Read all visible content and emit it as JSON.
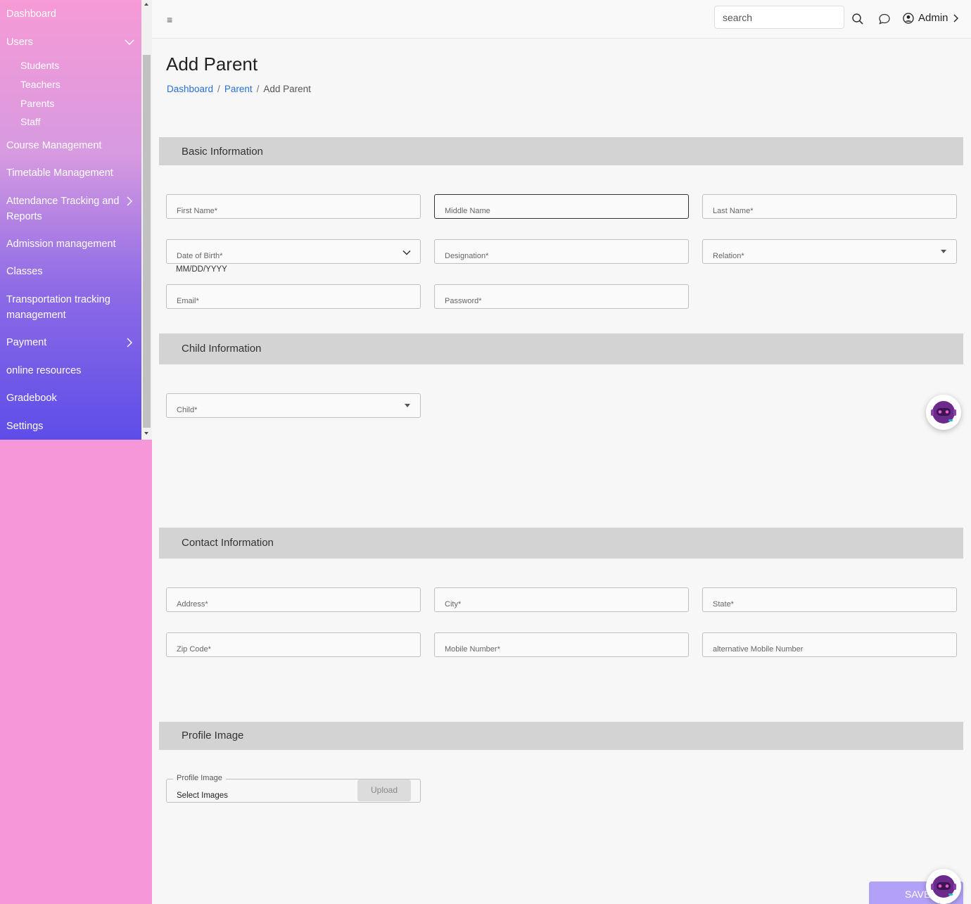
{
  "sidebar": {
    "items": [
      {
        "label": "Dashboard"
      },
      {
        "label": "Users"
      },
      {
        "label": "Course Management"
      },
      {
        "label": "Timetable Management"
      },
      {
        "label": "Attendance Tracking and Reports"
      },
      {
        "label": "Admission management"
      },
      {
        "label": "Classes"
      },
      {
        "label": "Transportation tracking management"
      },
      {
        "label": "Payment"
      },
      {
        "label": "online resources"
      },
      {
        "label": "Gradebook"
      },
      {
        "label": "Settings"
      }
    ],
    "users_sub": [
      "Students",
      "Teachers",
      "Parents",
      "Staff"
    ]
  },
  "header": {
    "menu_icon": "≡",
    "search_placeholder": "search",
    "user_label": "Admin"
  },
  "page": {
    "title": "Add Parent",
    "breadcrumb": [
      "Dashboard",
      "Parent",
      "Add Parent"
    ]
  },
  "sections": {
    "basic": "Basic Information",
    "child": "Child Information",
    "contact": "Contact Information",
    "profile": "Profile Image"
  },
  "fields": {
    "first_name": "First Name*",
    "middle_name": "Middle Name",
    "last_name": "Last Name*",
    "dob": "Date of Birth*",
    "dob_hint": "MM/DD/YYYY",
    "designation": "Designation*",
    "relation": "Relation*",
    "email": "Email*",
    "password": "Password*",
    "child": "Child*",
    "address": "Address*",
    "city": "City*",
    "state": "State*",
    "zip": "Zip Code*",
    "mobile": "Mobile Number*",
    "alt_mobile": "alternative Mobile Number"
  },
  "upload": {
    "legend": "Profile Image",
    "select": "Select Images",
    "button": "Upload"
  },
  "save_label": "SAVE"
}
